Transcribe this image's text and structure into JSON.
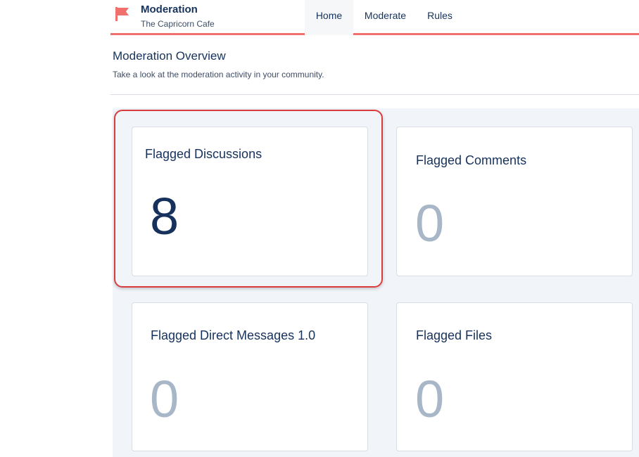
{
  "app": {
    "title": "Moderation",
    "subtitle": "The Capricorn Cafe"
  },
  "tabs": [
    {
      "label": "Home",
      "active": true
    },
    {
      "label": "Moderate",
      "active": false
    },
    {
      "label": "Rules",
      "active": false
    }
  ],
  "page": {
    "title": "Moderation Overview",
    "description": "Take a look at the moderation activity in your community."
  },
  "cards": [
    {
      "label": "Flagged Discussions",
      "value": "8"
    },
    {
      "label": "Flagged Comments",
      "value": "0"
    },
    {
      "label": "Flagged Direct Messages 1.0",
      "value": "0"
    },
    {
      "label": "Flagged Files",
      "value": "0"
    }
  ],
  "colors": {
    "accent": "#f0706e",
    "highlight": "#d93c3c",
    "text": "#16325c",
    "zero_value": "#a8b7c7"
  }
}
